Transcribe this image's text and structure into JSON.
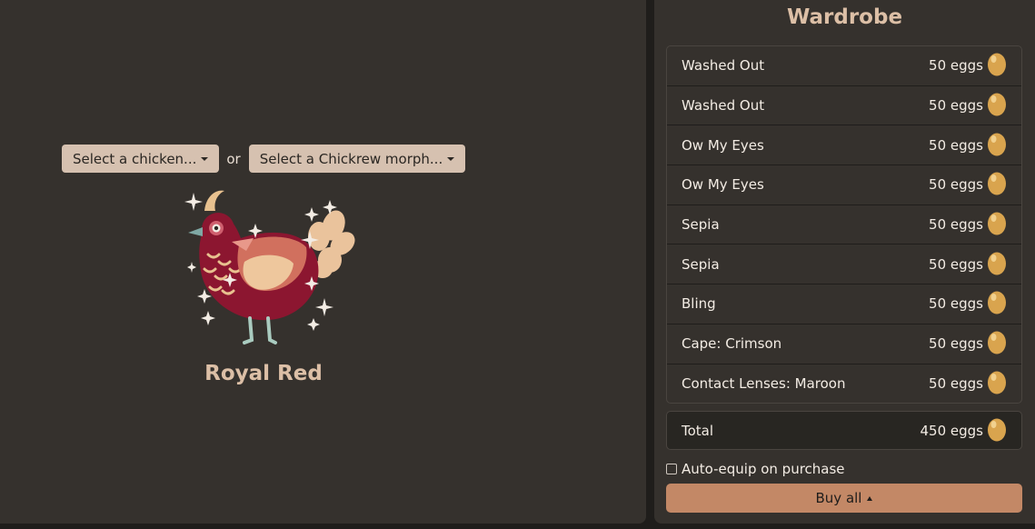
{
  "selectors": {
    "chicken_label": "Select a chicken...",
    "or_label": "or",
    "morph_label": "Select a Chickrew morph..."
  },
  "chicken": {
    "name": "Royal Red"
  },
  "wardrobe": {
    "title": "Wardrobe",
    "items": [
      {
        "name": "Washed Out",
        "price": "50 eggs"
      },
      {
        "name": "Washed Out",
        "price": "50 eggs"
      },
      {
        "name": "Ow My Eyes",
        "price": "50 eggs"
      },
      {
        "name": "Ow My Eyes",
        "price": "50 eggs"
      },
      {
        "name": "Sepia",
        "price": "50 eggs"
      },
      {
        "name": "Sepia",
        "price": "50 eggs"
      },
      {
        "name": "Bling",
        "price": "50 eggs"
      },
      {
        "name": "Cape: Crimson",
        "price": "50 eggs"
      },
      {
        "name": "Contact Lenses: Maroon",
        "price": "50 eggs"
      }
    ],
    "total_label": "Total",
    "total_price": "450 eggs",
    "auto_equip_label": "Auto-equip on purchase",
    "auto_equip_checked": false,
    "buy_label": "Buy all"
  },
  "icons": {
    "currency": "egg-icon",
    "dropdown": "caret-down-icon",
    "buy_menu": "caret-up-icon"
  },
  "colors": {
    "accent": "#c38866",
    "title": "#dcbfa6",
    "egg": "#d9a44e",
    "panel": "#35312d"
  }
}
